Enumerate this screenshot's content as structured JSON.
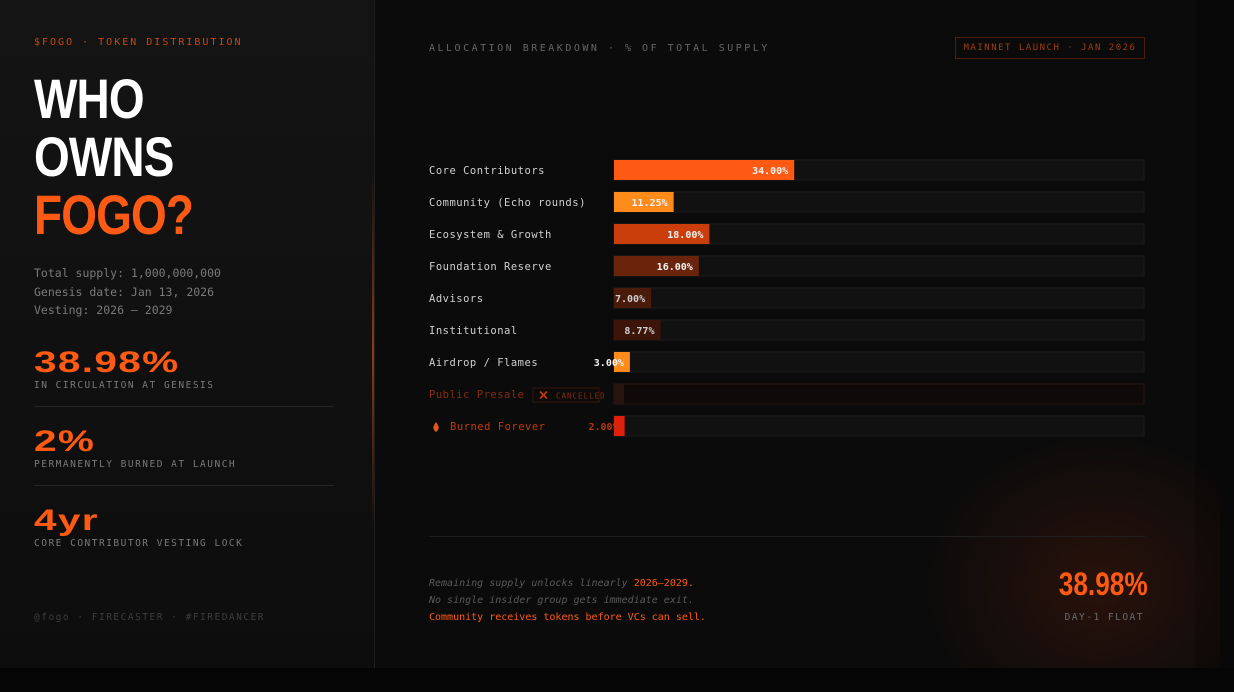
{
  "left": {
    "eyebrow": "$FOGO · TOKEN DISTRIBUTION",
    "headline": [
      "WHO",
      "OWNS",
      "FOGO?"
    ],
    "meta": [
      "Total supply: 1,000,000,000",
      "Genesis date: Jan 13, 2026",
      "Vesting: 2026 – 2029"
    ],
    "stats": [
      {
        "value": "38.98%",
        "label": "IN CIRCULATION AT GENESIS"
      },
      {
        "value": "2%",
        "label": "PERMANENTLY BURNED AT LAUNCH"
      },
      {
        "value": "4yr",
        "label": "CORE CONTRIBUTOR VESTING LOCK"
      }
    ],
    "footer": "@fogo · FIRECASTER · #FIREDANCER"
  },
  "header": {
    "title": "ALLOCATION BREAKDOWN · % OF TOTAL SUPPLY",
    "badge": "MAINNET LAUNCH · JAN 2026"
  },
  "chart_data": {
    "type": "bar",
    "orientation": "horizontal",
    "title": "ALLOCATION BREAKDOWN · % OF TOTAL SUPPLY",
    "xlim": [
      0,
      100
    ],
    "categories": [
      "Core Contributors",
      "Community (Echo rounds)",
      "Ecosystem & Growth",
      "Foundation Reserve",
      "Advisors",
      "Institutional",
      "Airdrop / Flames",
      "Public Presale",
      "Burned Forever"
    ],
    "values": [
      34.0,
      11.25,
      18.0,
      16.0,
      7.0,
      8.77,
      3.0,
      0,
      2.0
    ],
    "data_labels": [
      "34.00%",
      "11.25%",
      "18.00%",
      "16.00%",
      "7.00%",
      "8.77%",
      "3.00%",
      "",
      "2.00%"
    ],
    "colors": [
      "#ff5a14",
      "#ff8c1a",
      "#c93e0a",
      "#6b240c",
      "#4a1a0a",
      "#3d140a",
      "#ff8c1a",
      "#2a1410",
      "#e0200c"
    ],
    "label_colors": [
      "#f2f2f2",
      "#f2f2f2",
      "#f2f2f2",
      "#f2f2f2",
      "#cfcfcf",
      "#cfcfcf",
      "#f2f2f2",
      "#8a2a0c",
      "#b9350c"
    ],
    "cancelled_tag": "CANCELLED",
    "burn_icon": "flame-icon"
  },
  "notes": {
    "line1_pre": "Remaining supply unlocks linearly ",
    "line1_hl": "2026–2029.",
    "line2": "No single insider group gets immediate exit.",
    "line3": "Community receives tokens before VCs can sell."
  },
  "float": {
    "value": "38.98%",
    "label": "DAY-1 FLOAT"
  }
}
